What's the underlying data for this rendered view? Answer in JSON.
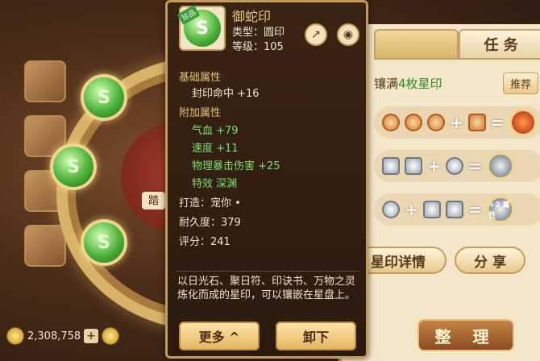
{
  "tooltip": {
    "name": "御蛇印",
    "badge": "珍品",
    "type_line": "类型：圆印",
    "level_line": "等级：105",
    "base_section": "基础属性",
    "base_attrs": [
      "封印命中 +16"
    ],
    "extra_section": "附加属性",
    "extra_attrs": [
      "气血 +79",
      "速度 +11",
      "物理暴击伤害 +25",
      "特效 深渊"
    ],
    "forge_line": "打造：宠你 •",
    "durability_line": "耐久度：379",
    "score_line": "评分：241",
    "description": "以日光石、聚日符、印诀书、万物之灵炼化而成的星印，可以镶嵌在星盘上。",
    "more_btn": "更多 ^",
    "unequip_btn": "卸下",
    "share_icon": "share-icon",
    "view_icon": "eye-icon"
  },
  "right_panel": {
    "tabs": [
      "",
      "任 务"
    ],
    "hint_prefix": "镶满",
    "hint_highlight": "4枚星印",
    "recommend_btn": "推荐",
    "recipe3_label": "+2\n属性",
    "detail_btn": "星印详情",
    "share_btn": "分 享"
  },
  "scene": {
    "bubble": "踏"
  },
  "bottom": {
    "coins": "2,308,758",
    "arrange_btn": "整 理"
  }
}
